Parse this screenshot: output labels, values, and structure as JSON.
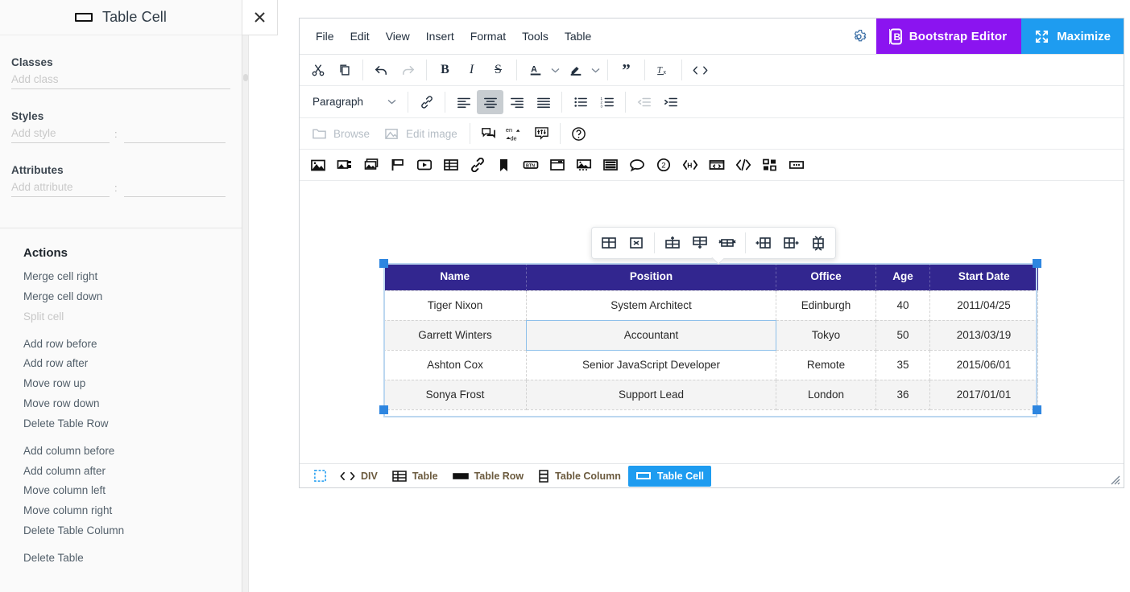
{
  "sidebar": {
    "title": "Table Cell",
    "title_icon": "table-cell-icon",
    "close_icon": "close-icon",
    "fields": {
      "classes_label": "Classes",
      "classes_placeholder": "Add class",
      "styles_label": "Styles",
      "styles_name_placeholder": "Add style",
      "styles_value_placeholder": "",
      "attributes_label": "Attributes",
      "attributes_name_placeholder": "Add attribute",
      "attributes_value_placeholder": "",
      "colon": ":"
    },
    "actions_title": "Actions",
    "actions": [
      {
        "label": "Merge cell right",
        "disabled": false,
        "gap_after": false
      },
      {
        "label": "Merge cell down",
        "disabled": false,
        "gap_after": false
      },
      {
        "label": "Split cell",
        "disabled": true,
        "gap_after": true
      },
      {
        "label": "Add row before",
        "disabled": false,
        "gap_after": false
      },
      {
        "label": "Add row after",
        "disabled": false,
        "gap_after": false
      },
      {
        "label": "Move row up",
        "disabled": false,
        "gap_after": false
      },
      {
        "label": "Move row down",
        "disabled": false,
        "gap_after": false
      },
      {
        "label": "Delete Table Row",
        "disabled": false,
        "gap_after": true
      },
      {
        "label": "Add column before",
        "disabled": false,
        "gap_after": false
      },
      {
        "label": "Add column after",
        "disabled": false,
        "gap_after": false
      },
      {
        "label": "Move column left",
        "disabled": false,
        "gap_after": false
      },
      {
        "label": "Move column right",
        "disabled": false,
        "gap_after": false
      },
      {
        "label": "Delete Table Column",
        "disabled": false,
        "gap_after": true
      },
      {
        "label": "Delete Table",
        "disabled": false,
        "gap_after": false
      }
    ]
  },
  "editor": {
    "menus": [
      "File",
      "Edit",
      "View",
      "Insert",
      "Format",
      "Tools",
      "Table"
    ],
    "gear_icon": "gear-icon",
    "brand_button": {
      "label": "Bootstrap Editor",
      "icon": "bootstrap-b-icon",
      "color": "#8b14f0"
    },
    "maximize_button": {
      "label": "Maximize",
      "icon": "expand-arrows-icon",
      "color": "#1e9cf0"
    },
    "toolbar_row1": [
      {
        "icon": "cut-icon",
        "glyph": "✂",
        "state": "normal"
      },
      {
        "icon": "copy-icon",
        "glyph": "⧉",
        "state": "normal"
      },
      {
        "sep": true
      },
      {
        "icon": "undo-icon",
        "glyph": "↶",
        "state": "normal"
      },
      {
        "icon": "redo-icon",
        "glyph": "↷",
        "state": "disabled"
      },
      {
        "sep": true
      },
      {
        "icon": "bold-icon",
        "glyph": "B",
        "state": "normal"
      },
      {
        "icon": "italic-icon",
        "glyph": "I",
        "state": "normal"
      },
      {
        "icon": "strikethrough-icon",
        "glyph": "S",
        "state": "normal"
      },
      {
        "sep": true
      },
      {
        "icon": "text-color-icon",
        "glyph": "A",
        "state": "normal",
        "caret": true
      },
      {
        "icon": "highlight-color-icon",
        "glyph": "pen",
        "state": "normal",
        "caret": true
      },
      {
        "sep": true
      },
      {
        "icon": "blockquote-icon",
        "glyph": "”",
        "state": "normal"
      },
      {
        "sep": true
      },
      {
        "icon": "clear-formatting-icon",
        "glyph": "Tx",
        "state": "normal"
      },
      {
        "sep": true
      },
      {
        "icon": "source-code-icon",
        "glyph": "<>",
        "state": "normal"
      }
    ],
    "format_select": {
      "value": "Paragraph",
      "caret_icon": "chevron-down-icon"
    },
    "toolbar_row2": [
      {
        "icon": "insert-link-icon",
        "state": "normal"
      },
      {
        "sep": true
      },
      {
        "icon": "align-left-icon",
        "state": "normal"
      },
      {
        "icon": "align-center-icon",
        "state": "active"
      },
      {
        "icon": "align-right-icon",
        "state": "normal"
      },
      {
        "icon": "align-justify-icon",
        "state": "normal"
      },
      {
        "sep": true
      },
      {
        "icon": "bullet-list-icon",
        "state": "normal"
      },
      {
        "icon": "numbered-list-icon",
        "state": "normal"
      },
      {
        "sep": true
      },
      {
        "icon": "outdent-icon",
        "state": "disabled"
      },
      {
        "icon": "indent-icon",
        "state": "normal"
      }
    ],
    "toolbar_row3": {
      "browse_label": "Browse",
      "browse_icon": "folder-icon",
      "edit_image_label": "Edit image",
      "edit_image_icon": "edit-image-icon",
      "icons": [
        {
          "icon": "comments-icon"
        },
        {
          "icon": "language-translate-icon",
          "text_top": "en",
          "text_bottom": "de"
        },
        {
          "icon": "settings-sliders-icon"
        }
      ],
      "help_icon": "help-circle-icon"
    },
    "toolbar_row4": [
      {
        "icon": "insert-image-icon"
      },
      {
        "icon": "image-gallery-icon"
      },
      {
        "icon": "media-stack-icon"
      },
      {
        "icon": "flag-icon"
      },
      {
        "icon": "insert-video-icon"
      },
      {
        "icon": "insert-table-icon"
      },
      {
        "icon": "link-icon"
      },
      {
        "icon": "bookmark-icon"
      },
      {
        "icon": "button-icon"
      },
      {
        "icon": "window-icon"
      },
      {
        "icon": "figure-image-icon"
      },
      {
        "icon": "page-layout-icon"
      },
      {
        "icon": "speech-bubble-icon"
      },
      {
        "icon": "numbered-badge-icon"
      },
      {
        "icon": "html-tag-icon"
      },
      {
        "icon": "embed-frame-icon"
      },
      {
        "icon": "code-icon"
      },
      {
        "icon": "grid-blocks-icon"
      },
      {
        "icon": "more-options-icon"
      }
    ],
    "table_context_toolbar": [
      {
        "icon": "table-properties-icon"
      },
      {
        "icon": "delete-table-icon"
      },
      {
        "sep": true
      },
      {
        "icon": "insert-row-above-icon"
      },
      {
        "icon": "insert-row-below-icon"
      },
      {
        "icon": "delete-row-icon"
      },
      {
        "sep": true
      },
      {
        "icon": "insert-column-before-icon"
      },
      {
        "icon": "insert-column-after-icon"
      },
      {
        "icon": "delete-column-icon"
      }
    ],
    "statusbar": {
      "crumbs": [
        {
          "label": "",
          "icon": "element-selector-icon",
          "selected": false
        },
        {
          "label": "DIV",
          "icon": "code-tag-icon",
          "selected": false
        },
        {
          "label": "Table",
          "icon": "table-icon",
          "selected": false
        },
        {
          "label": "Table Row",
          "icon": "table-row-icon",
          "selected": false
        },
        {
          "label": "Table Column",
          "icon": "table-column-icon",
          "selected": false
        },
        {
          "label": "Table Cell",
          "icon": "table-cell-icon",
          "selected": true
        }
      ],
      "resize_icon": "resize-grip-icon"
    }
  },
  "table": {
    "header_color": "#32268f",
    "selected_cell": {
      "row": 1,
      "col": 1
    },
    "columns": [
      "Name",
      "Position",
      "Office",
      "Age",
      "Start Date"
    ],
    "rows": [
      [
        "Tiger Nixon",
        "System Architect",
        "Edinburgh",
        "40",
        "2011/04/25"
      ],
      [
        "Garrett Winters",
        "Accountant",
        "Tokyo",
        "50",
        "2013/03/19"
      ],
      [
        "Ashton Cox",
        "Senior JavaScript Developer",
        "Remote",
        "35",
        "2015/06/01"
      ],
      [
        "Sonya Frost",
        "Support Lead",
        "London",
        "36",
        "2017/01/01"
      ]
    ]
  }
}
